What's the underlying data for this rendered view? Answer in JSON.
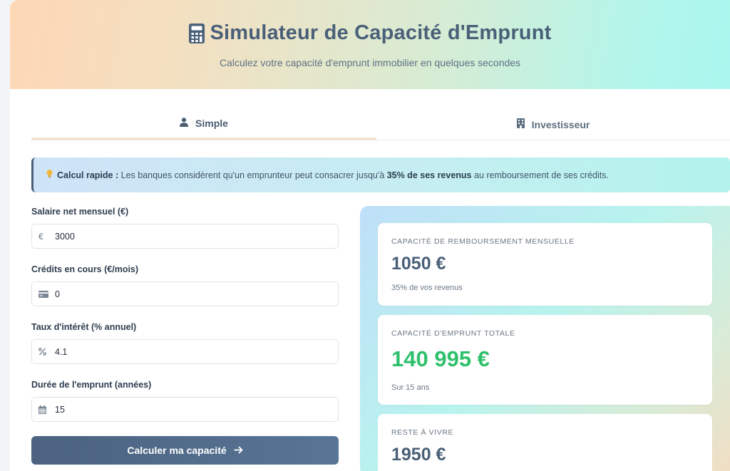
{
  "header": {
    "title": "Simulateur de Capacité d'Emprunt",
    "subtitle": "Calculez votre capacité d'emprunt immobilier en quelques secondes",
    "icon": "calculator-icon"
  },
  "tabs": [
    {
      "label": "Simple",
      "icon": "user-icon",
      "active": true
    },
    {
      "label": "Investisseur",
      "icon": "building-icon",
      "active": false
    }
  ],
  "info": {
    "icon": "lightbulb-icon",
    "lead": "Calcul rapide :",
    "text_before": " Les banques considèrent qu'un emprunteur peut consacrer jusqu'à ",
    "highlight": "35% de ses revenus",
    "text_after": " au remboursement de ses crédits."
  },
  "form": {
    "fields": [
      {
        "label": "Salaire net mensuel (€)",
        "icon": "euro-icon",
        "value": "3000"
      },
      {
        "label": "Crédits en cours (€/mois)",
        "icon": "credit-card-icon",
        "value": "0"
      },
      {
        "label": "Taux d'intérêt (% annuel)",
        "icon": "percent-icon",
        "value": "4.1"
      },
      {
        "label": "Durée de l'emprunt (années)",
        "icon": "calendar-icon",
        "value": "15"
      }
    ],
    "submit_label": "Calculer ma capacité"
  },
  "results": [
    {
      "label": "Capacité de remboursement mensuelle",
      "value": "1050 €",
      "note": "35% de vos revenus"
    },
    {
      "label": "Capacité d'emprunt totale",
      "value": "140 995 €",
      "note": "Sur 15 ans",
      "color": "#2fc06c"
    },
    {
      "label": "Reste à vivre",
      "value": "1950 €",
      "note": ""
    }
  ],
  "colors": {
    "primary": "#4a6078",
    "accent_green": "#2fc06c"
  }
}
